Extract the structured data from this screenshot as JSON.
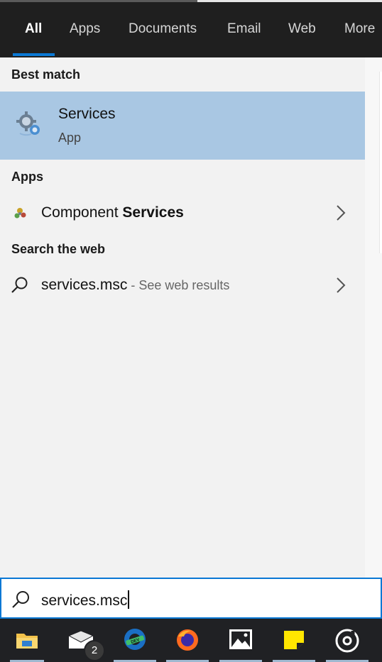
{
  "tabs": [
    {
      "label": "All",
      "active": true
    },
    {
      "label": "Apps"
    },
    {
      "label": "Documents"
    },
    {
      "label": "Email"
    },
    {
      "label": "Web"
    },
    {
      "label": "More"
    }
  ],
  "sections": {
    "best_match": "Best match",
    "apps": "Apps",
    "web": "Search the web"
  },
  "best_match": {
    "title": "Services",
    "subtitle": "App",
    "icon": "services-gear-icon"
  },
  "apps": [
    {
      "prefix": "Component ",
      "match": "Services",
      "icon": "component-services-icon"
    }
  ],
  "web": [
    {
      "query": "services.msc",
      "suffix": " - See web results",
      "icon": "search-icon"
    }
  ],
  "search": {
    "value": "services.msc"
  },
  "taskbar": {
    "mail_badge": "2",
    "items": [
      "file-explorer-icon",
      "mail-icon",
      "edge-dev-icon",
      "firefox-icon",
      "photos-icon",
      "sticky-notes-icon",
      "groove-music-icon"
    ]
  },
  "colors": {
    "accent": "#0a78d4",
    "selection": "#a9c7e3",
    "topbar": "#1f1f1f",
    "taskbar": "#202124"
  }
}
